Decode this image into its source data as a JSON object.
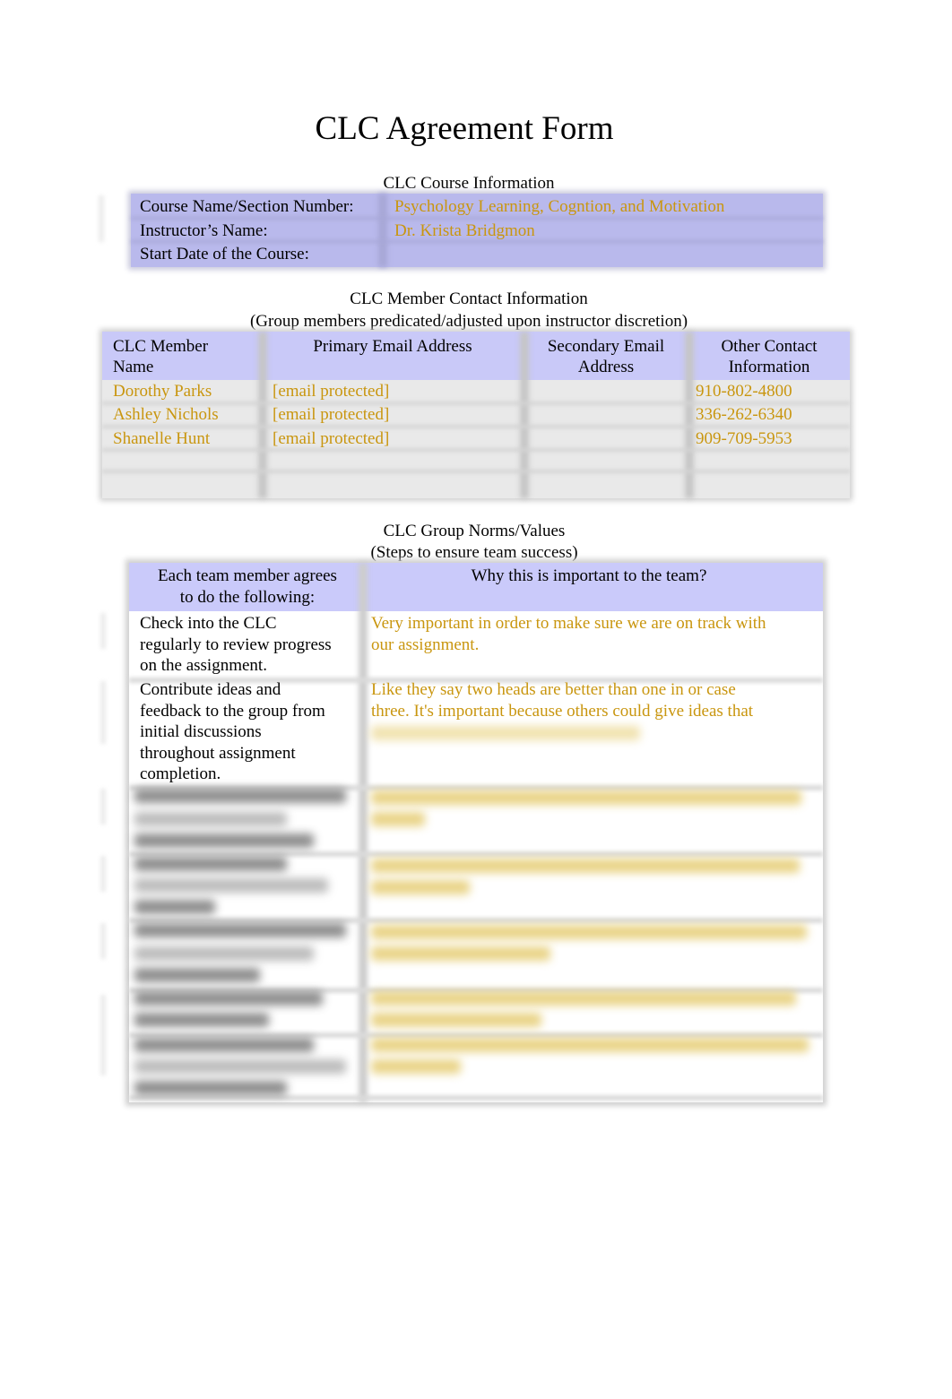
{
  "document": {
    "title": "CLC Agreement Form"
  },
  "course_info": {
    "caption": "CLC Course Information",
    "rows": [
      {
        "label": "Course Name/Section Number:",
        "value": "Psychology Learning, Cogntion, and Motivation"
      },
      {
        "label": "Instructor’s Name:",
        "value": "Dr. Krista Bridgmon"
      },
      {
        "label": "Start Date of the Course:",
        "value": ""
      }
    ]
  },
  "member_contacts": {
    "caption": "CLC Member Contact Information",
    "subcaption": "(Group members predicated/adjusted upon instructor discretion)",
    "columns": [
      "CLC Member Name",
      "Primary Email Address",
      "Secondary Email Address",
      "Other Contact Information"
    ],
    "column_lines": [
      [
        "CLC Member",
        "Name"
      ],
      [
        "Primary Email Address",
        ""
      ],
      [
        "Secondary Email",
        "Address"
      ],
      [
        "Other Contact",
        "Information"
      ]
    ],
    "rows": [
      {
        "name": "Dorothy Parks",
        "primary_email": "[email protected]",
        "secondary_email": "",
        "other": "910-802-4800"
      },
      {
        "name": "Ashley Nichols",
        "primary_email": "[email protected]",
        "secondary_email": "",
        "other": "336-262-6340"
      },
      {
        "name": "Shanelle Hunt",
        "primary_email": "[email protected]",
        "secondary_email": "",
        "other": "909-709-5953"
      },
      {
        "name": "",
        "primary_email": "",
        "secondary_email": "",
        "other": ""
      },
      {
        "name": "",
        "primary_email": "",
        "secondary_email": "",
        "other": ""
      }
    ]
  },
  "group_norms": {
    "caption": "CLC Group Norms/Values",
    "subcaption": "(Steps to ensure team success)",
    "columns": [
      "Each team member agrees to do the following:",
      "Why this is important to the team?"
    ],
    "column_lines": [
      [
        "Each team member agrees",
        "to do the following:"
      ],
      [
        "Why this is important to the team?"
      ]
    ],
    "rows": [
      {
        "agreement_lines": [
          "Check into the CLC",
          "regularly to review progress",
          "on the assignment."
        ],
        "importance_lines": [
          "Very important in order to make sure we are on track with",
          "our assignment."
        ]
      },
      {
        "agreement_lines": [
          "Contribute ideas and",
          "feedback to the group from",
          "initial discussions",
          "throughout assignment",
          "completion."
        ],
        "importance_lines": [
          "Like they say two heads are better than one in or case",
          "three.  It's important because others could give ideas that"
        ]
      }
    ],
    "obscured_rows": 6
  },
  "colors": {
    "header_fill": "#c9c9f8",
    "course_fill": "#b9b9ec",
    "filled_text": "#c9960f"
  }
}
